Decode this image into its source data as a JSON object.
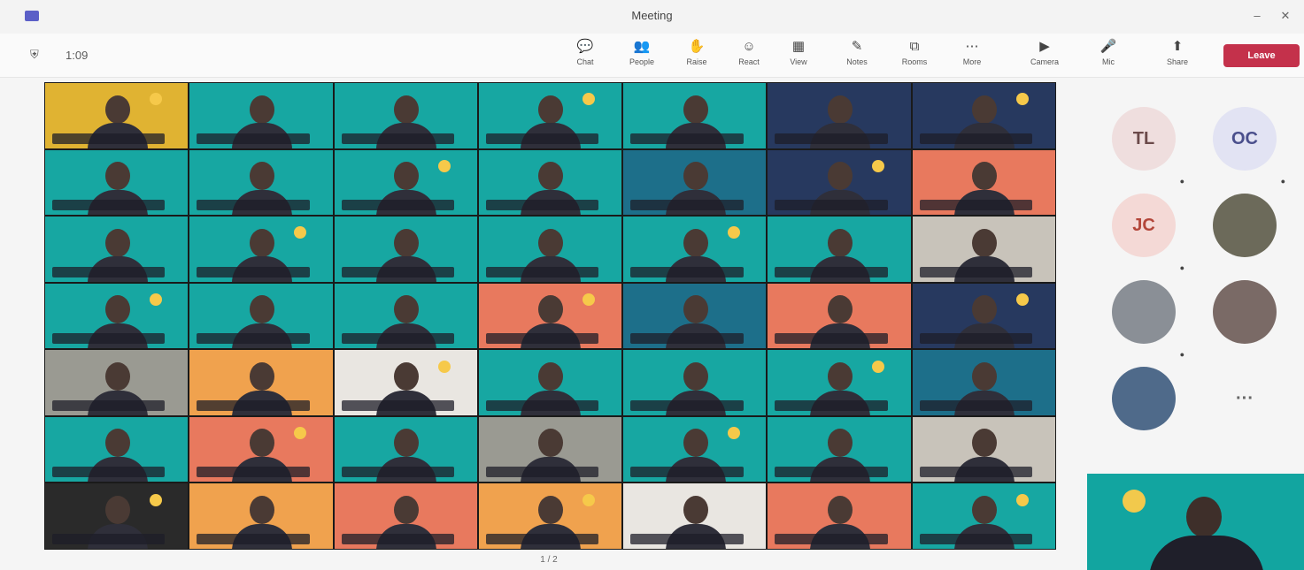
{
  "window": {
    "title": "Meeting"
  },
  "toolbar": {
    "timer": "1:09",
    "buttons": [
      {
        "label": "Chat",
        "icon": "chat-icon",
        "glyph": "💬"
      },
      {
        "label": "People",
        "icon": "people-icon",
        "glyph": "👥"
      },
      {
        "label": "Raise",
        "icon": "raise-hand-icon",
        "glyph": "✋"
      },
      {
        "label": "React",
        "icon": "react-icon",
        "glyph": "☺"
      },
      {
        "label": "View",
        "icon": "view-icon",
        "glyph": "▦"
      },
      {
        "label": "Notes",
        "icon": "notes-icon",
        "glyph": "✎"
      },
      {
        "label": "Rooms",
        "icon": "rooms-icon",
        "glyph": "⧉"
      },
      {
        "label": "More",
        "icon": "more-icon",
        "glyph": "⋯"
      },
      {
        "label": "Camera",
        "icon": "camera-icon",
        "glyph": "▶"
      },
      {
        "label": "Mic",
        "icon": "mic-icon",
        "glyph": "🎤"
      },
      {
        "label": "Share",
        "icon": "share-icon",
        "glyph": "⬆"
      }
    ],
    "leave_label": "Leave"
  },
  "sidebar": {
    "participants": [
      {
        "initials": "TL",
        "name": "",
        "bg": "#efdede",
        "fg": "#6b4a4a"
      },
      {
        "initials": "OC",
        "name": "",
        "bg": "#e2e3f3",
        "fg": "#4a4f8c"
      },
      {
        "initials": "JC",
        "name": "",
        "bg": "#f4d9d6",
        "fg": "#b3463a"
      },
      {
        "initials": "",
        "name": "",
        "bg": "#6c6a5a",
        "fg": "#ffffff"
      },
      {
        "initials": "",
        "name": "",
        "bg": "#8a8f96",
        "fg": "#ffffff"
      },
      {
        "initials": "",
        "name": "",
        "bg": "#7a6a66",
        "fg": "#ffffff"
      },
      {
        "initials": "",
        "name": "",
        "bg": "#4f6a8a",
        "fg": "#ffffff"
      },
      {
        "initials": "···",
        "name": "",
        "bg": "#f5f5f5",
        "fg": "#666666"
      }
    ]
  },
  "page_indicator": "1 / 2",
  "colors": {
    "teal": "#17a7a2",
    "orange": "#f0a24e",
    "pink": "#e8795e",
    "leave": "#c4314b"
  }
}
